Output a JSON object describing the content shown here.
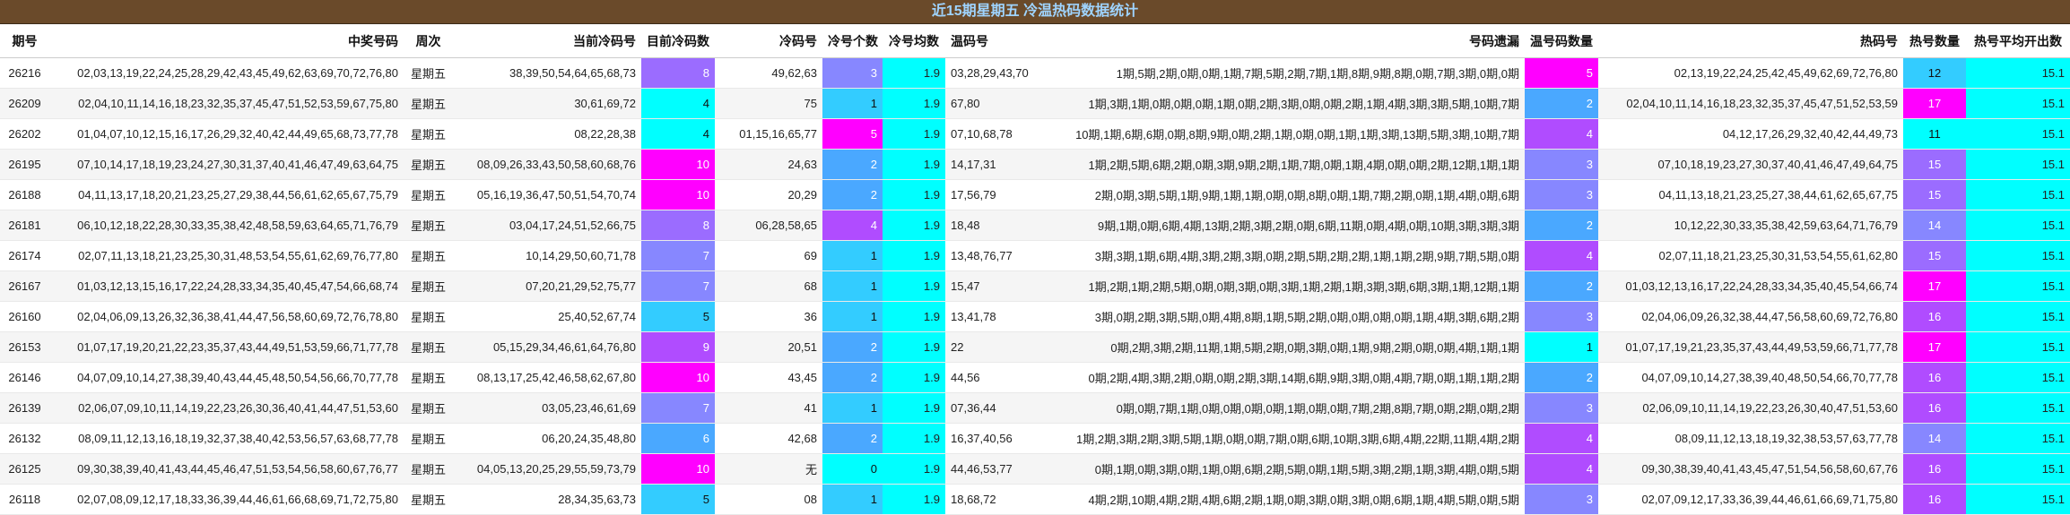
{
  "title": "近15期星期五 冷温热码数据统计",
  "headers": [
    "期号",
    "中奖号码",
    "周次",
    "当前冷码号",
    "目前冷码数",
    "冷码号",
    "冷号个数",
    "冷号均数",
    "温码号",
    "号码遗漏",
    "温号码数量",
    "热码号",
    "热号数量",
    "热号平均开出数"
  ],
  "colors": {
    "magenta": "#ff00ff",
    "violet": "#b04cff",
    "purple": "#9b6cff",
    "periwinkle": "#8787ff",
    "blue": "#4aa8ff",
    "skyblue": "#33ccff",
    "cyan": "#00ffff",
    "title_bg": "#6a4a2a",
    "title_text": "#9fd4ff"
  },
  "rows": [
    {
      "issue": "26216",
      "winning": "02,03,13,19,22,24,25,28,29,42,43,45,49,62,63,69,70,72,76,80",
      "weekday": "星期五",
      "cur_cold": "38,39,50,54,64,65,68,73",
      "cur_cold_count": "8",
      "cold": "49,62,63",
      "cold_count": "3",
      "cold_avg": "1.9",
      "warm": "03,28,29,43,70",
      "miss": "1期,5期,2期,0期,0期,1期,7期,5期,2期,7期,1期,8期,9期,8期,0期,7期,3期,0期,0期",
      "warm_count": "5",
      "hot": "02,13,19,22,24,25,42,45,49,62,69,72,76,80",
      "hot_count": "12",
      "hot_avg": "15.1"
    },
    {
      "issue": "26209",
      "winning": "02,04,10,11,14,16,18,23,32,35,37,45,47,51,52,53,59,67,75,80",
      "weekday": "星期五",
      "cur_cold": "30,61,69,72",
      "cur_cold_count": "4",
      "cold": "75",
      "cold_count": "1",
      "cold_avg": "1.9",
      "warm": "67,80",
      "miss": "1期,3期,1期,0期,0期,0期,1期,0期,2期,3期,0期,0期,2期,1期,4期,3期,3期,5期,10期,7期",
      "warm_count": "2",
      "hot": "02,04,10,11,14,16,18,23,32,35,37,45,47,51,52,53,59",
      "hot_count": "17",
      "hot_avg": "15.1"
    },
    {
      "issue": "26202",
      "winning": "01,04,07,10,12,15,16,17,26,29,32,40,42,44,49,65,68,73,77,78",
      "weekday": "星期五",
      "cur_cold": "08,22,28,38",
      "cur_cold_count": "4",
      "cold": "01,15,16,65,77",
      "cold_count": "5",
      "cold_avg": "1.9",
      "warm": "07,10,68,78",
      "miss": "10期,1期,6期,6期,0期,8期,9期,0期,2期,1期,0期,0期,1期,1期,3期,13期,5期,3期,10期,7期",
      "warm_count": "4",
      "hot": "04,12,17,26,29,32,40,42,44,49,73",
      "hot_count": "11",
      "hot_avg": "15.1"
    },
    {
      "issue": "26195",
      "winning": "07,10,14,17,18,19,23,24,27,30,31,37,40,41,46,47,49,63,64,75",
      "weekday": "星期五",
      "cur_cold": "08,09,26,33,43,50,58,60,68,76",
      "cur_cold_count": "10",
      "cold": "24,63",
      "cold_count": "2",
      "cold_avg": "1.9",
      "warm": "14,17,31",
      "miss": "1期,2期,5期,6期,2期,0期,3期,9期,2期,1期,7期,0期,1期,4期,0期,0期,2期,12期,1期,1期",
      "warm_count": "3",
      "hot": "07,10,18,19,23,27,30,37,40,41,46,47,49,64,75",
      "hot_count": "15",
      "hot_avg": "15.1"
    },
    {
      "issue": "26188",
      "winning": "04,11,13,17,18,20,21,23,25,27,29,38,44,56,61,62,65,67,75,79",
      "weekday": "星期五",
      "cur_cold": "05,16,19,36,47,50,51,54,70,74",
      "cur_cold_count": "10",
      "cold": "20,29",
      "cold_count": "2",
      "cold_avg": "1.9",
      "warm": "17,56,79",
      "miss": "2期,0期,3期,5期,1期,9期,1期,1期,0期,0期,8期,0期,1期,7期,2期,0期,1期,4期,0期,6期",
      "warm_count": "3",
      "hot": "04,11,13,18,21,23,25,27,38,44,61,62,65,67,75",
      "hot_count": "15",
      "hot_avg": "15.1"
    },
    {
      "issue": "26181",
      "winning": "06,10,12,18,22,28,30,33,35,38,42,48,58,59,63,64,65,71,76,79",
      "weekday": "星期五",
      "cur_cold": "03,04,17,24,51,52,66,75",
      "cur_cold_count": "8",
      "cold": "06,28,58,65",
      "cold_count": "4",
      "cold_avg": "1.9",
      "warm": "18,48",
      "miss": "9期,1期,0期,6期,4期,13期,2期,3期,2期,0期,6期,11期,0期,4期,0期,10期,3期,3期,3期",
      "warm_count": "2",
      "hot": "10,12,22,30,33,35,38,42,59,63,64,71,76,79",
      "hot_count": "14",
      "hot_avg": "15.1"
    },
    {
      "issue": "26174",
      "winning": "02,07,11,13,18,21,23,25,30,31,48,53,54,55,61,62,69,76,77,80",
      "weekday": "星期五",
      "cur_cold": "10,14,29,50,60,71,78",
      "cur_cold_count": "7",
      "cold": "69",
      "cold_count": "1",
      "cold_avg": "1.9",
      "warm": "13,48,76,77",
      "miss": "3期,3期,1期,6期,4期,3期,2期,3期,0期,2期,5期,2期,2期,1期,1期,2期,9期,7期,5期,0期",
      "warm_count": "4",
      "hot": "02,07,11,18,21,23,25,30,31,53,54,55,61,62,80",
      "hot_count": "15",
      "hot_avg": "15.1"
    },
    {
      "issue": "26167",
      "winning": "01,03,12,13,15,16,17,22,24,28,33,34,35,40,45,47,54,66,68,74",
      "weekday": "星期五",
      "cur_cold": "07,20,21,29,52,75,77",
      "cur_cold_count": "7",
      "cold": "68",
      "cold_count": "1",
      "cold_avg": "1.9",
      "warm": "15,47",
      "miss": "1期,2期,1期,2期,5期,0期,0期,3期,0期,3期,1期,2期,1期,3期,3期,6期,3期,1期,12期,1期",
      "warm_count": "2",
      "hot": "01,03,12,13,16,17,22,24,28,33,34,35,40,45,54,66,74",
      "hot_count": "17",
      "hot_avg": "15.1"
    },
    {
      "issue": "26160",
      "winning": "02,04,06,09,13,26,32,36,38,41,44,47,56,58,60,69,72,76,78,80",
      "weekday": "星期五",
      "cur_cold": "25,40,52,67,74",
      "cur_cold_count": "5",
      "cold": "36",
      "cold_count": "1",
      "cold_avg": "1.9",
      "warm": "13,41,78",
      "miss": "3期,0期,2期,3期,5期,0期,4期,8期,1期,5期,2期,0期,0期,0期,0期,1期,4期,3期,6期,2期",
      "warm_count": "3",
      "hot": "02,04,06,09,26,32,38,44,47,56,58,60,69,72,76,80",
      "hot_count": "16",
      "hot_avg": "15.1"
    },
    {
      "issue": "26153",
      "winning": "01,07,17,19,20,21,22,23,35,37,43,44,49,51,53,59,66,71,77,78",
      "weekday": "星期五",
      "cur_cold": "05,15,29,34,46,61,64,76,80",
      "cur_cold_count": "9",
      "cold": "20,51",
      "cold_count": "2",
      "cold_avg": "1.9",
      "warm": "22",
      "miss": "0期,2期,3期,2期,11期,1期,5期,2期,0期,3期,0期,1期,9期,2期,0期,0期,4期,1期,1期",
      "warm_count": "1",
      "hot": "01,07,17,19,21,23,35,37,43,44,49,53,59,66,71,77,78",
      "hot_count": "17",
      "hot_avg": "15.1"
    },
    {
      "issue": "26146",
      "winning": "04,07,09,10,14,27,38,39,40,43,44,45,48,50,54,56,66,70,77,78",
      "weekday": "星期五",
      "cur_cold": "08,13,17,25,42,46,58,62,67,80",
      "cur_cold_count": "10",
      "cold": "43,45",
      "cold_count": "2",
      "cold_avg": "1.9",
      "warm": "44,56",
      "miss": "0期,2期,4期,3期,2期,0期,0期,2期,3期,14期,6期,9期,3期,0期,4期,7期,0期,1期,1期,2期",
      "warm_count": "2",
      "hot": "04,07,09,10,14,27,38,39,40,48,50,54,66,70,77,78",
      "hot_count": "16",
      "hot_avg": "15.1"
    },
    {
      "issue": "26139",
      "winning": "02,06,07,09,10,11,14,19,22,23,26,30,36,40,41,44,47,51,53,60",
      "weekday": "星期五",
      "cur_cold": "03,05,23,46,61,69",
      "cur_cold_count": "7",
      "cold": "41",
      "cold_count": "1",
      "cold_avg": "1.9",
      "warm": "07,36,44",
      "miss": "0期,0期,7期,1期,0期,0期,0期,0期,1期,0期,0期,7期,2期,8期,7期,0期,2期,0期,2期",
      "warm_count": "3",
      "hot": "02,06,09,10,11,14,19,22,23,26,30,40,47,51,53,60",
      "hot_count": "16",
      "hot_avg": "15.1"
    },
    {
      "issue": "26132",
      "winning": "08,09,11,12,13,16,18,19,32,37,38,40,42,53,56,57,63,68,77,78",
      "weekday": "星期五",
      "cur_cold": "06,20,24,35,48,80",
      "cur_cold_count": "6",
      "cold": "42,68",
      "cold_count": "2",
      "cold_avg": "1.9",
      "warm": "16,37,40,56",
      "miss": "1期,2期,3期,2期,3期,5期,1期,0期,0期,7期,0期,6期,10期,3期,6期,4期,22期,11期,4期,2期",
      "warm_count": "4",
      "hot": "08,09,11,12,13,18,19,32,38,53,57,63,77,78",
      "hot_count": "14",
      "hot_avg": "15.1"
    },
    {
      "issue": "26125",
      "winning": "09,30,38,39,40,41,43,44,45,46,47,51,53,54,56,58,60,67,76,77",
      "weekday": "星期五",
      "cur_cold": "04,05,13,20,25,29,55,59,73,79",
      "cur_cold_count": "10",
      "cold": "无",
      "cold_count": "0",
      "cold_avg": "1.9",
      "warm": "44,46,53,77",
      "miss": "0期,1期,0期,3期,0期,1期,0期,6期,2期,5期,0期,1期,5期,3期,2期,1期,3期,4期,0期,5期",
      "warm_count": "4",
      "hot": "09,30,38,39,40,41,43,45,47,51,54,56,58,60,67,76",
      "hot_count": "16",
      "hot_avg": "15.1"
    },
    {
      "issue": "26118",
      "winning": "02,07,08,09,12,17,18,33,36,39,44,46,61,66,68,69,71,72,75,80",
      "weekday": "星期五",
      "cur_cold": "28,34,35,63,73",
      "cur_cold_count": "5",
      "cold": "08",
      "cold_count": "1",
      "cold_avg": "1.9",
      "warm": "18,68,72",
      "miss": "4期,2期,10期,4期,2期,4期,6期,2期,1期,0期,3期,0期,3期,0期,6期,1期,4期,5期,0期,5期",
      "warm_count": "3",
      "hot": "02,07,09,12,17,33,36,39,44,46,61,66,69,71,75,80",
      "hot_count": "16",
      "hot_avg": "15.1"
    }
  ]
}
